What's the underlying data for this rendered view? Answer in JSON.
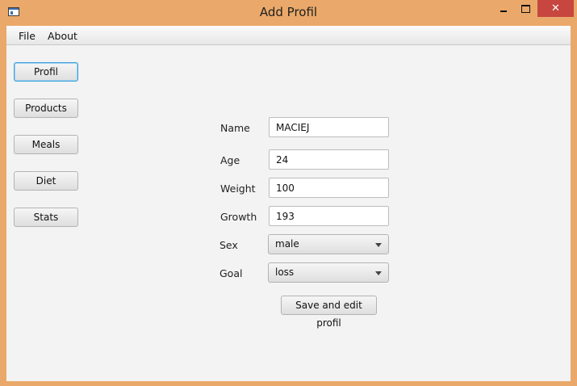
{
  "window": {
    "title": "Add Profil",
    "close_glyph": "✕",
    "controls": [
      "app-icon",
      "minimize-icon",
      "maximize-icon",
      "close-icon"
    ]
  },
  "menu": {
    "file": "File",
    "about": "About"
  },
  "nav": {
    "items": [
      {
        "label": "Profil",
        "active": true
      },
      {
        "label": "Products",
        "active": false
      },
      {
        "label": "Meals",
        "active": false
      },
      {
        "label": "Diet",
        "active": false
      },
      {
        "label": "Stats",
        "active": false
      }
    ]
  },
  "form": {
    "name": {
      "label": "Name",
      "value": "MACIEJ"
    },
    "age": {
      "label": "Age",
      "value": "24"
    },
    "weight": {
      "label": "Weight",
      "value": "100"
    },
    "growth": {
      "label": "Growth",
      "value": "193"
    },
    "sex": {
      "label": "Sex",
      "value": "male"
    },
    "goal": {
      "label": "Goal",
      "value": "loss"
    },
    "save_label": "Save and edit profil"
  },
  "colors": {
    "frame": "#eaa96a",
    "close_button": "#c7463f",
    "focus_border": "#3aa0dc",
    "content_bg": "#f3f3f3"
  }
}
